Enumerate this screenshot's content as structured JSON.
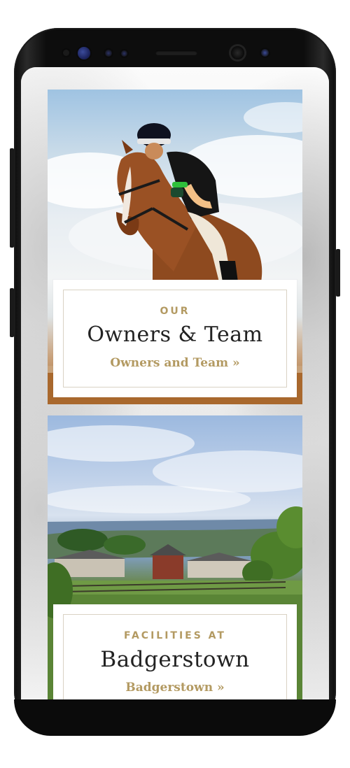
{
  "cards": [
    {
      "eyebrow": "OUR",
      "title": "Owners & Team",
      "link": "Owners and Team »",
      "image": "horse-and-rider-photo"
    },
    {
      "eyebrow": "FACILITIES AT",
      "title": "Badgerstown",
      "link": "Badgerstown »",
      "image": "countryside-farm-photo"
    }
  ],
  "colors": {
    "accent": "#b39a62",
    "heading": "#222222",
    "panel": "#ffffff",
    "border": "#d9d2c4"
  }
}
